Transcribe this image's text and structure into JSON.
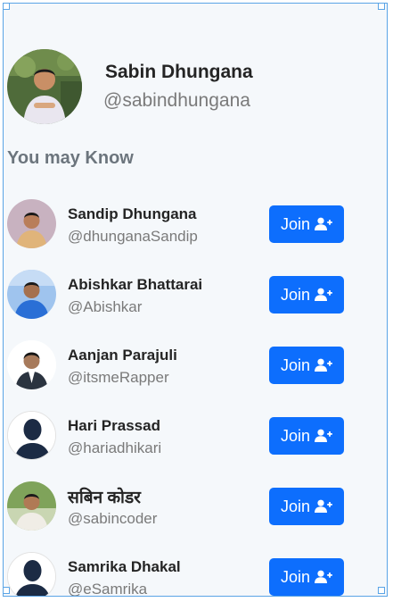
{
  "profile": {
    "name": "Sabin Dhungana",
    "handle": "@sabindhungana"
  },
  "section_heading": "You may Know",
  "suggestions": [
    {
      "name": "Sandip Dhungana",
      "handle": "@dhunganaSandip",
      "join_label": "Join",
      "avatar": "photo"
    },
    {
      "name": "Abishkar Bhattarai",
      "handle": "@Abishkar",
      "join_label": "Join",
      "avatar": "photo"
    },
    {
      "name": "Aanjan Parajuli",
      "handle": "@itsmeRapper",
      "join_label": "Join",
      "avatar": "photo"
    },
    {
      "name": "Hari Prassad",
      "handle": "@hariadhikari",
      "join_label": "Join",
      "avatar": "default-user-silhouette"
    },
    {
      "name": "सबिन कोडर",
      "handle": "@sabincoder",
      "join_label": "Join",
      "avatar": "photo"
    },
    {
      "name": "Samrika Dhakal",
      "handle": "@eSamrika",
      "join_label": "Join",
      "avatar": "default-user-silhouette"
    }
  ],
  "icons": {
    "join": "user-plus-icon"
  },
  "colors": {
    "primary": "#0d6efd",
    "background": "#f5f8fb",
    "text": "#242424",
    "muted": "#7a7a7a",
    "selection": "#5aa4e6"
  }
}
